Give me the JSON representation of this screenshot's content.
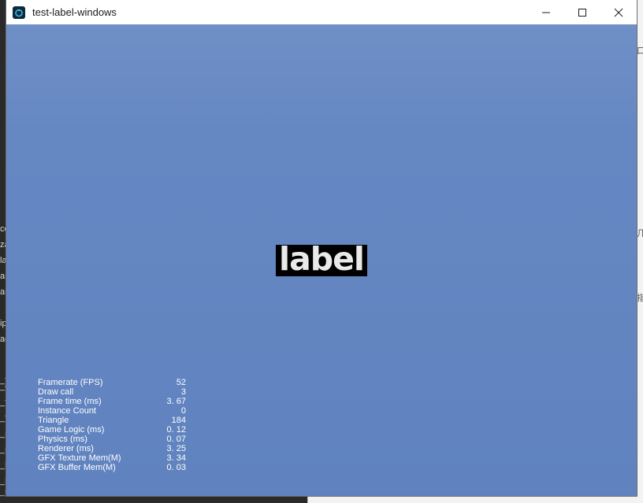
{
  "window": {
    "title": "test-label-windows",
    "icon": "cocos-app-icon",
    "controls": [
      "minimize-icon",
      "maximize-icon",
      "close-icon"
    ]
  },
  "scene": {
    "label_text": "label",
    "background_color": "#6587c2",
    "label_bg_color": "#000000",
    "label_text_color": "#e9e9e9"
  },
  "stats": [
    {
      "label": "Framerate (FPS)",
      "value": "52"
    },
    {
      "label": "Draw call",
      "value": "3"
    },
    {
      "label": "Frame time (ms)",
      "value": "3. 67"
    },
    {
      "label": "Instance Count",
      "value": "0"
    },
    {
      "label": "Triangle",
      "value": "184"
    },
    {
      "label": "Game Logic (ms)",
      "value": "0. 12"
    },
    {
      "label": "Physics (ms)",
      "value": "0. 07"
    },
    {
      "label": "Renderer (ms)",
      "value": "3. 25"
    },
    {
      "label": "GFX Texture Mem(M)",
      "value": "3. 34"
    },
    {
      "label": "GFX Buffer Mem(M)",
      "value": "0. 03"
    }
  ],
  "background_fragments": {
    "left": [
      "ce",
      "za",
      "la",
      "ar",
      "ar",
      "ip",
      "ac",
      "_c",
      "_f",
      "_f",
      "_r",
      "_r",
      "_l",
      "_r",
      "_s",
      "_t"
    ],
    "right": [
      "口.",
      "几状",
      "指"
    ]
  }
}
